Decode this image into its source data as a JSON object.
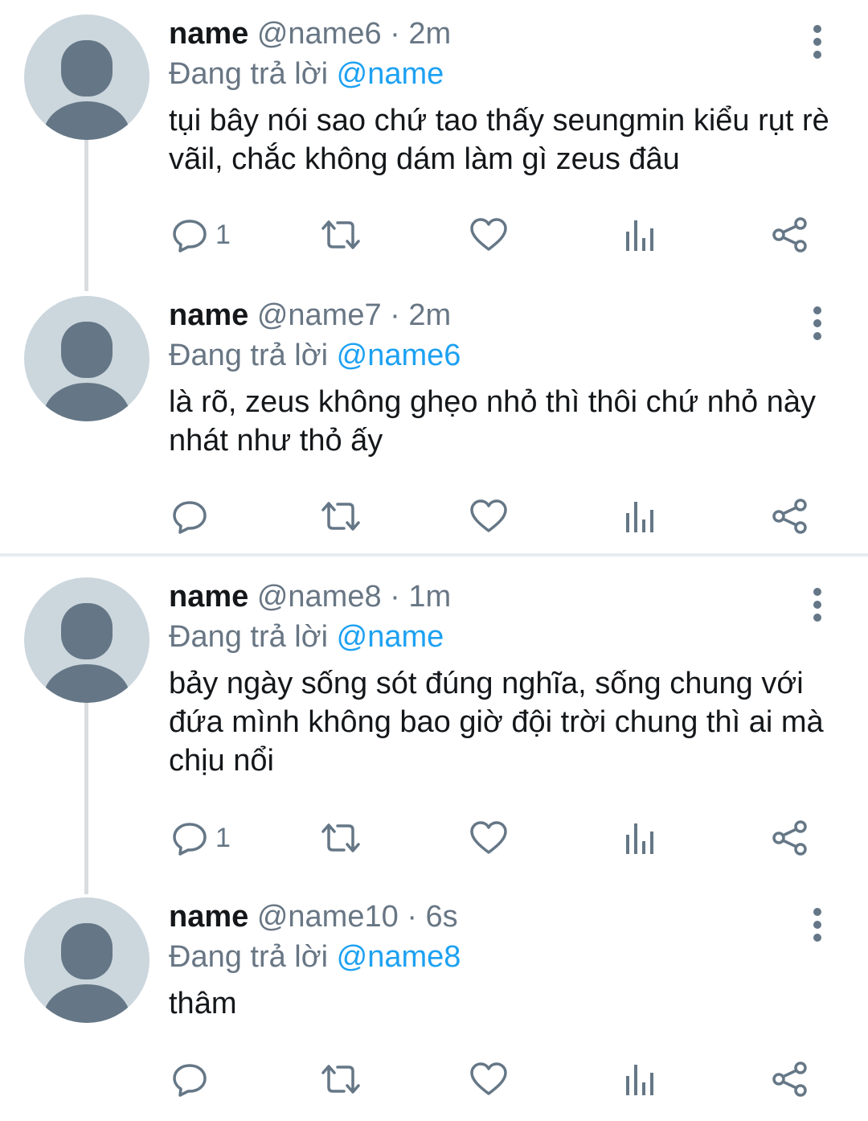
{
  "tweets": [
    {
      "name": "name",
      "handle": "@name6",
      "time": "· 2m",
      "reply_prefix": "Đang trả lời",
      "reply_to": "@name",
      "text": "tụi bây nói sao chứ tao thấy seungmin kiểu rụt rè vãil, chắc không dám làm gì zeus đâu",
      "reply_count": "1"
    },
    {
      "name": "name",
      "handle": "@name7",
      "time": "· 2m",
      "reply_prefix": "Đang trả lời",
      "reply_to": "@name6",
      "text": "là rõ, zeus không ghẹo nhỏ thì thôi chứ nhỏ này nhát như thỏ ấy",
      "reply_count": ""
    },
    {
      "name": "name",
      "handle": "@name8",
      "time": "· 1m",
      "reply_prefix": "Đang trả lời",
      "reply_to": "@name",
      "text": "bảy ngày sống sót đúng nghĩa, sống chung với đứa mình không bao giờ đội trời chung thì ai mà chịu nổi",
      "reply_count": "1"
    },
    {
      "name": "name",
      "handle": "@name10",
      "time": "· 6s",
      "reply_prefix": "Đang trả lời",
      "reply_to": "@name8",
      "text": "thâm",
      "reply_count": ""
    }
  ],
  "icons": {
    "reply": "reply-icon",
    "retweet": "retweet-icon",
    "like": "heart-icon",
    "analytics": "analytics-icon",
    "share": "share-icon",
    "more": "more-vertical-icon"
  },
  "colors": {
    "name": "#14171a",
    "meta": "#687684",
    "mention": "#1da1f2",
    "icon": "#657786",
    "avatar_bg": "#ccd6dd",
    "avatar_fg": "#657786",
    "thread_line": "#d9dde0"
  }
}
